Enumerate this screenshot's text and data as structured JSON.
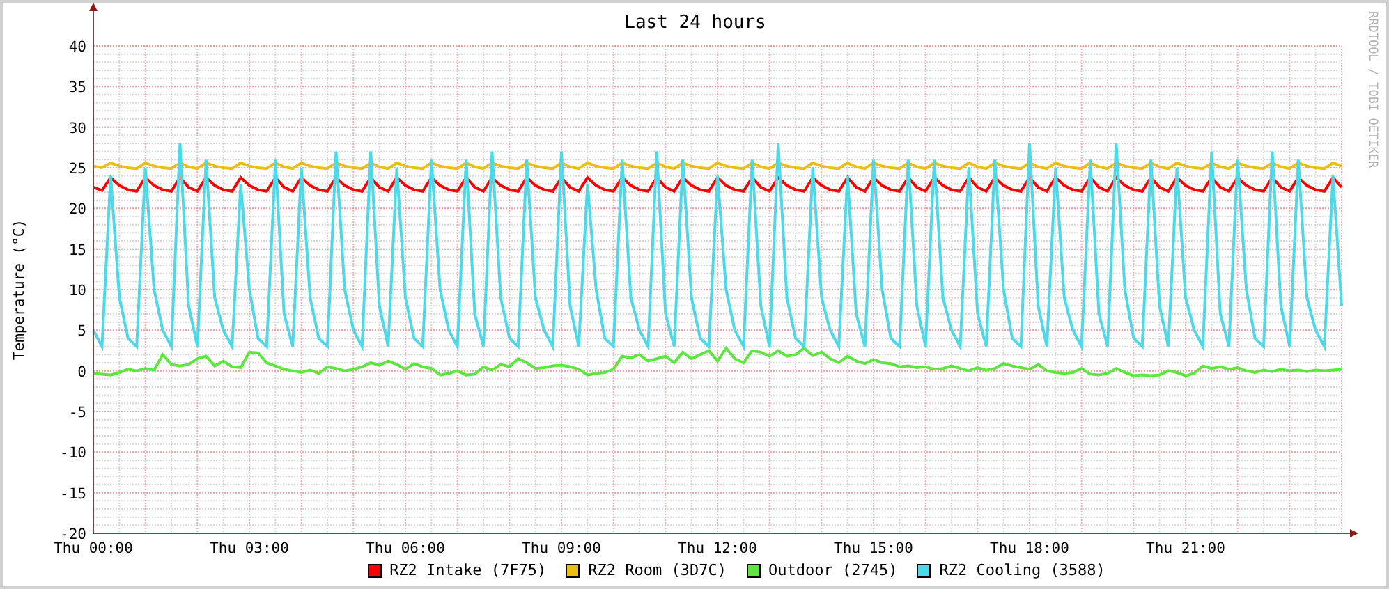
{
  "title": "Last 24 hours",
  "side_text": "RRDTOOL / TOBI OETIKER",
  "chart_data": {
    "type": "line",
    "ylabel": "Temperature (°C)",
    "categories": [
      "Thu 00:00",
      null,
      null,
      null,
      null,
      null,
      null,
      null,
      null,
      null,
      null,
      null,
      null,
      null,
      null,
      null,
      null,
      null,
      "Thu 03:00",
      null,
      null,
      null,
      null,
      null,
      null,
      null,
      null,
      null,
      null,
      null,
      null,
      null,
      null,
      null,
      null,
      null,
      "Thu 06:00",
      null,
      null,
      null,
      null,
      null,
      null,
      null,
      null,
      null,
      null,
      null,
      null,
      null,
      null,
      null,
      null,
      null,
      "Thu 09:00",
      null,
      null,
      null,
      null,
      null,
      null,
      null,
      null,
      null,
      null,
      null,
      null,
      null,
      null,
      null,
      null,
      null,
      "Thu 12:00",
      null,
      null,
      null,
      null,
      null,
      null,
      null,
      null,
      null,
      null,
      null,
      null,
      null,
      null,
      null,
      null,
      null,
      "Thu 15:00",
      null,
      null,
      null,
      null,
      null,
      null,
      null,
      null,
      null,
      null,
      null,
      null,
      null,
      null,
      null,
      null,
      null,
      "Thu 18:00",
      null,
      null,
      null,
      null,
      null,
      null,
      null,
      null,
      null,
      null,
      null,
      null,
      null,
      null,
      null,
      null,
      null,
      "Thu 21:00",
      null,
      null,
      null,
      null,
      null,
      null,
      null,
      null,
      null,
      null,
      null,
      null,
      null,
      null,
      null,
      null,
      null,
      null
    ],
    "ylim": [
      -20,
      40
    ],
    "grid": true,
    "yticks": [
      -20,
      -15,
      -10,
      -5,
      0,
      5,
      10,
      15,
      20,
      25,
      30,
      35,
      40
    ],
    "series": [
      {
        "name": "RZ2 Intake (7F75)",
        "color": "#ff0000",
        "values": [
          22.6,
          22.2,
          23.8,
          22.8,
          22.3,
          22.1,
          23.8,
          22.8,
          22.3,
          22.1,
          23.8,
          22.6,
          22.1,
          23.8,
          22.8,
          22.3,
          22.1,
          23.8,
          22.8,
          22.3,
          22.1,
          23.8,
          22.6,
          22.1,
          23.8,
          22.8,
          22.3,
          22.1,
          23.8,
          22.8,
          22.3,
          22.1,
          23.8,
          22.6,
          22.1,
          23.8,
          22.8,
          22.3,
          22.1,
          23.8,
          22.8,
          22.3,
          22.1,
          23.8,
          22.6,
          22.1,
          23.8,
          22.8,
          22.3,
          22.1,
          23.8,
          22.8,
          22.3,
          22.1,
          23.8,
          22.6,
          22.1,
          23.8,
          22.8,
          22.3,
          22.1,
          23.8,
          22.8,
          22.3,
          22.1,
          23.8,
          22.6,
          22.1,
          23.8,
          22.8,
          22.3,
          22.1,
          23.8,
          22.8,
          22.3,
          22.1,
          23.8,
          22.6,
          22.1,
          23.8,
          22.8,
          22.3,
          22.1,
          23.8,
          22.8,
          22.3,
          22.1,
          23.8,
          22.6,
          22.1,
          23.8,
          22.8,
          22.3,
          22.1,
          23.8,
          22.6,
          22.1,
          23.8,
          22.8,
          22.3,
          22.1,
          23.8,
          22.6,
          22.1,
          23.8,
          22.8,
          22.3,
          22.1,
          23.8,
          22.6,
          22.1,
          23.8,
          22.8,
          22.3,
          22.1,
          23.8,
          22.6,
          22.1,
          23.8,
          22.8,
          22.3,
          22.1,
          23.8,
          22.6,
          22.1,
          23.8,
          22.8,
          22.3,
          22.1,
          23.8,
          22.6,
          22.1,
          23.8,
          22.8,
          22.3,
          22.1,
          23.8,
          22.6,
          22.1,
          23.8,
          22.8,
          22.3,
          22.1,
          23.8,
          22.6
        ]
      },
      {
        "name": "RZ2 Room (3D7C)",
        "color": "#ecbd16",
        "values": [
          25.2,
          25.0,
          25.6,
          25.2,
          25.0,
          24.9,
          25.6,
          25.2,
          25.0,
          24.9,
          25.6,
          25.1,
          24.9,
          25.6,
          25.2,
          25.0,
          24.9,
          25.6,
          25.2,
          25.0,
          24.9,
          25.6,
          25.1,
          24.9,
          25.6,
          25.2,
          25.0,
          24.9,
          25.6,
          25.2,
          25.0,
          24.9,
          25.6,
          25.1,
          24.9,
          25.6,
          25.2,
          25.0,
          24.9,
          25.6,
          25.2,
          25.0,
          24.9,
          25.6,
          25.1,
          24.9,
          25.6,
          25.2,
          25.0,
          24.9,
          25.6,
          25.2,
          25.0,
          24.9,
          25.6,
          25.1,
          24.9,
          25.6,
          25.2,
          25.0,
          24.9,
          25.6,
          25.2,
          25.0,
          24.9,
          25.6,
          25.1,
          24.9,
          25.6,
          25.2,
          25.0,
          24.9,
          25.6,
          25.2,
          25.0,
          24.9,
          25.6,
          25.1,
          24.9,
          25.6,
          25.2,
          25.0,
          24.9,
          25.6,
          25.2,
          25.0,
          24.9,
          25.6,
          25.1,
          24.9,
          25.6,
          25.2,
          25.0,
          24.9,
          25.6,
          25.1,
          24.9,
          25.6,
          25.2,
          25.0,
          24.9,
          25.6,
          25.1,
          24.9,
          25.6,
          25.2,
          25.0,
          24.9,
          25.6,
          25.1,
          24.9,
          25.6,
          25.2,
          25.0,
          24.9,
          25.6,
          25.1,
          24.9,
          25.6,
          25.2,
          25.0,
          24.9,
          25.6,
          25.1,
          24.9,
          25.6,
          25.2,
          25.0,
          24.9,
          25.6,
          25.1,
          24.9,
          25.6,
          25.2,
          25.0,
          24.9,
          25.6,
          25.1,
          24.9,
          25.6,
          25.2,
          25.0,
          24.9,
          25.6,
          25.2
        ]
      },
      {
        "name": "Outdoor (2745)",
        "color": "#5ce63f",
        "values": [
          -0.3,
          -0.4,
          -0.5,
          -0.2,
          0.2,
          0.0,
          0.3,
          0.1,
          2.0,
          0.8,
          0.6,
          0.8,
          1.5,
          1.8,
          0.6,
          1.2,
          0.5,
          0.4,
          2.3,
          2.2,
          1.0,
          0.6,
          0.2,
          0.0,
          -0.2,
          0.1,
          -0.3,
          0.5,
          0.3,
          0.0,
          0.2,
          0.5,
          1.0,
          0.7,
          1.2,
          0.8,
          0.2,
          0.9,
          0.5,
          0.3,
          -0.5,
          -0.3,
          0.0,
          -0.5,
          -0.4,
          0.5,
          0.1,
          0.8,
          0.5,
          1.5,
          1.0,
          0.3,
          0.4,
          0.6,
          0.7,
          0.5,
          0.2,
          -0.5,
          -0.3,
          -0.2,
          0.2,
          1.8,
          1.6,
          2.0,
          1.2,
          1.5,
          1.8,
          1.0,
          2.3,
          1.5,
          2.0,
          2.5,
          1.2,
          2.8,
          1.5,
          1.0,
          2.5,
          2.3,
          1.8,
          2.5,
          1.8,
          2.0,
          2.8,
          1.9,
          2.3,
          1.5,
          1.0,
          1.8,
          1.2,
          0.9,
          1.4,
          1.0,
          0.9,
          0.5,
          0.6,
          0.4,
          0.5,
          0.2,
          0.3,
          0.6,
          0.3,
          0.0,
          0.4,
          0.1,
          0.3,
          0.9,
          0.6,
          0.4,
          0.2,
          0.8,
          0.0,
          -0.2,
          -0.3,
          -0.2,
          0.3,
          -0.4,
          -0.5,
          -0.3,
          0.3,
          -0.2,
          -0.6,
          -0.5,
          -0.6,
          -0.5,
          0.0,
          -0.2,
          -0.6,
          -0.3,
          0.6,
          0.3,
          0.5,
          0.2,
          0.4,
          0.0,
          -0.2,
          0.1,
          -0.1,
          0.2,
          0.0,
          0.1,
          -0.1,
          0.1,
          0.0,
          0.1,
          0.2
        ]
      },
      {
        "name": "RZ2 Cooling (3588)",
        "color": "#4dd9ea",
        "values": [
          5,
          3,
          24,
          9,
          4,
          3,
          25,
          10,
          5,
          3,
          28,
          8,
          3,
          26,
          9,
          5,
          3,
          23,
          10,
          4,
          3,
          26,
          7,
          3,
          25,
          9,
          4,
          3,
          27,
          10,
          5,
          3,
          27,
          8,
          3,
          25,
          9,
          4,
          3,
          26,
          10,
          5,
          3,
          26,
          7,
          3,
          27,
          9,
          4,
          3,
          26,
          9,
          5,
          3,
          27,
          8,
          3,
          23,
          10,
          4,
          3,
          26,
          9,
          5,
          3,
          27,
          7,
          3,
          26,
          9,
          4,
          3,
          24,
          10,
          5,
          3,
          26,
          8,
          3,
          28,
          9,
          4,
          3,
          25,
          9,
          5,
          3,
          24,
          7,
          3,
          26,
          10,
          4,
          3,
          26,
          8,
          3,
          26,
          9,
          5,
          3,
          25,
          7,
          3,
          26,
          10,
          4,
          3,
          28,
          8,
          3,
          25,
          9,
          5,
          3,
          26,
          7,
          3,
          28,
          10,
          4,
          3,
          26,
          8,
          3,
          25,
          9,
          5,
          3,
          27,
          7,
          3,
          26,
          10,
          4,
          3,
          27,
          8,
          3,
          26,
          9,
          5,
          3,
          24,
          8
        ]
      }
    ]
  }
}
